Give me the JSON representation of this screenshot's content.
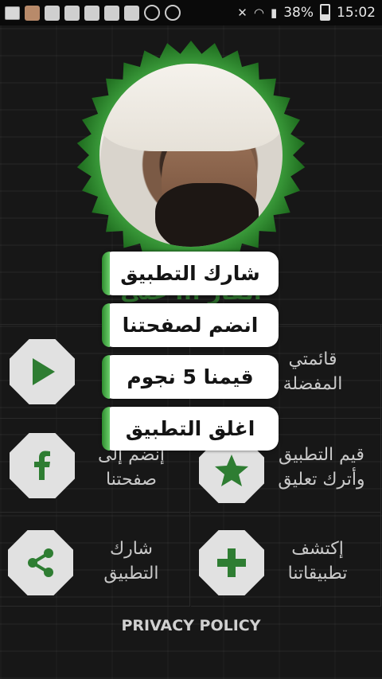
{
  "status_bar": {
    "battery": "38%",
    "time": "15:02"
  },
  "header": {
    "partial_title": "القار ... علي"
  },
  "grid": {
    "items": [
      {
        "label": "قائمتي\nالمفضلة",
        "icon": "play-icon"
      },
      {
        "label": "",
        "icon": "play-icon"
      },
      {
        "label": "قيم التطبيق\nوأترك تعليق",
        "icon": "star-icon"
      },
      {
        "label": "إنضم إلى\nصفحتنا",
        "icon": "facebook-icon"
      },
      {
        "label": "إكتشف\nتطبيقاتنا",
        "icon": "plus-icon"
      },
      {
        "label": "شارك\nالتطبيق",
        "icon": "share-icon"
      }
    ]
  },
  "footer": {
    "privacy": "PRIVACY POLICY"
  },
  "popup_menu": {
    "items": [
      "شارك التطبيق",
      "انضم لصفحتنا",
      "قيمنا 5 نجوم",
      "اغلق التطبيق"
    ]
  },
  "colors": {
    "accent_green": "#2e8b2e",
    "background": "#171717"
  }
}
